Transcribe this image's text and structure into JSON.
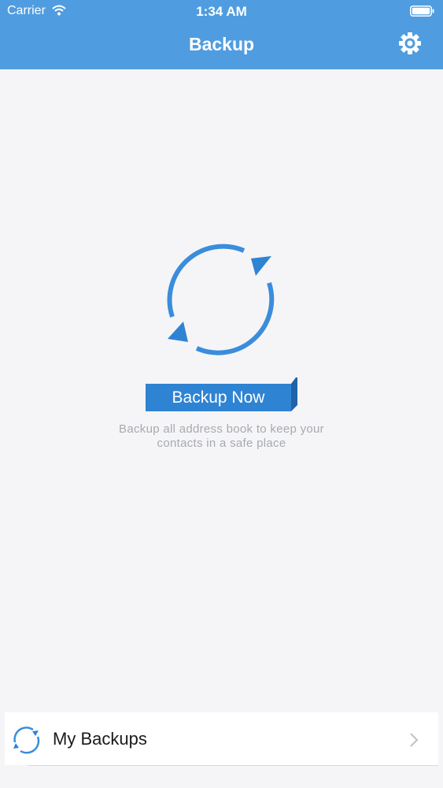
{
  "status_bar": {
    "carrier": "Carrier",
    "time": "1:34 AM",
    "wifi_icon": "wifi-icon",
    "battery_icon": "battery-icon"
  },
  "nav": {
    "title": "Backup",
    "settings_icon": "gear-icon"
  },
  "main": {
    "sync_icon": "sync-arrows-icon",
    "backup_button_label": "Backup Now",
    "description_line1": "Backup all address book to keep your",
    "description_line2": "contacts in a safe place"
  },
  "footer": {
    "my_backups_label": "My Backups",
    "icon": "sync-icon",
    "chevron_icon": "chevron-right-icon"
  },
  "colors": {
    "nav_bar": "#4f9de0",
    "accent": "#2f83d3",
    "button_shade": "#1f63a8",
    "background": "#f5f5f7",
    "description_text": "#a6aab0"
  }
}
